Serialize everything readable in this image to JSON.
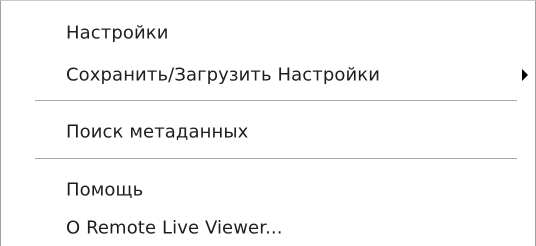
{
  "menu": {
    "items": [
      {
        "label": "Настройки"
      },
      {
        "label": "Сохранить/Загрузить Настройки",
        "submenu_icon": "chevron-right-icon"
      },
      {
        "label": "Поиск метаданных"
      },
      {
        "label": "Помощь"
      },
      {
        "label": "О Remote Live Viewer..."
      }
    ]
  },
  "colors": {
    "background": "#ffffff",
    "text": "#1e1e1e",
    "separator": "#a9a9a9",
    "border": "#a0a0a0"
  }
}
